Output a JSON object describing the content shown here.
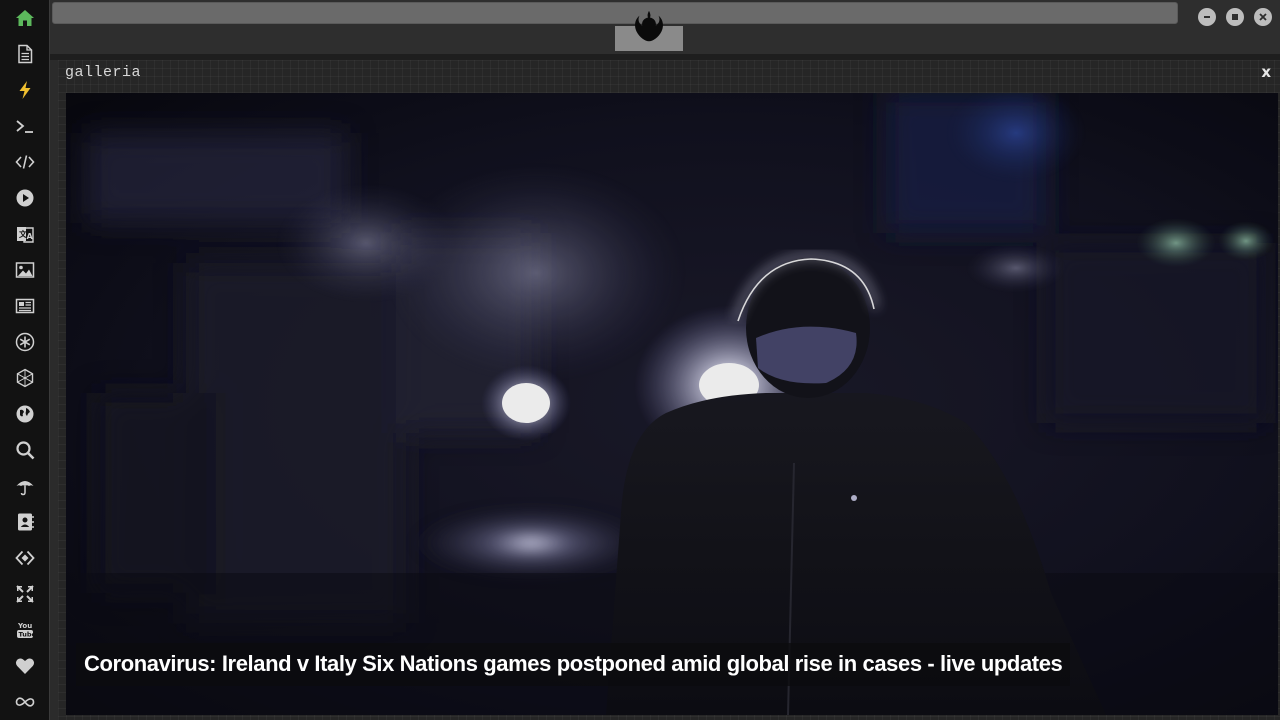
{
  "dock": {
    "items": [
      {
        "name": "home-icon",
        "color": "#5cb85c"
      },
      {
        "name": "document-icon",
        "color": "#d0d0d0"
      },
      {
        "name": "lightning-icon",
        "color": "#f0c030"
      },
      {
        "name": "terminal-icon",
        "color": "#d0d0d0"
      },
      {
        "name": "code-icon",
        "color": "#d0d0d0"
      },
      {
        "name": "play-icon",
        "color": "#d0d0d0"
      },
      {
        "name": "translate-icon",
        "color": "#d0d0d0"
      },
      {
        "name": "image-icon",
        "color": "#d0d0d0"
      },
      {
        "name": "newspaper-icon",
        "color": "#d0d0d0"
      },
      {
        "name": "asterisk-icon",
        "color": "#d0d0d0"
      },
      {
        "name": "hexagon-icon",
        "color": "#d0d0d0"
      },
      {
        "name": "globe-icon",
        "color": "#d0d0d0"
      },
      {
        "name": "search-icon",
        "color": "#d0d0d0"
      },
      {
        "name": "umbrella-icon",
        "color": "#d0d0d0"
      },
      {
        "name": "contacts-icon",
        "color": "#d0d0d0"
      },
      {
        "name": "diamond-code-icon",
        "color": "#d0d0d0"
      },
      {
        "name": "expand-icon",
        "color": "#d0d0d0"
      },
      {
        "name": "youtube-icon",
        "color": "#d0d0d0"
      },
      {
        "name": "heart-icon",
        "color": "#d0d0d0"
      },
      {
        "name": "infinity-icon",
        "color": "#d0d0d0"
      }
    ]
  },
  "topbar": {
    "logo": "rebel-alliance-icon",
    "window_controls": [
      "minimize-icon",
      "maximize-icon",
      "close-icon"
    ]
  },
  "galleria": {
    "title": "galleria",
    "close_label": "x",
    "caption": "Coronavirus: Ireland v Italy Six Nations games postponed amid global rise in cases - live updates"
  },
  "colors": {
    "dock_bg": "#121212",
    "window_bg": "#262626",
    "accent_green": "#5cb85c",
    "accent_yellow": "#f0c030"
  }
}
